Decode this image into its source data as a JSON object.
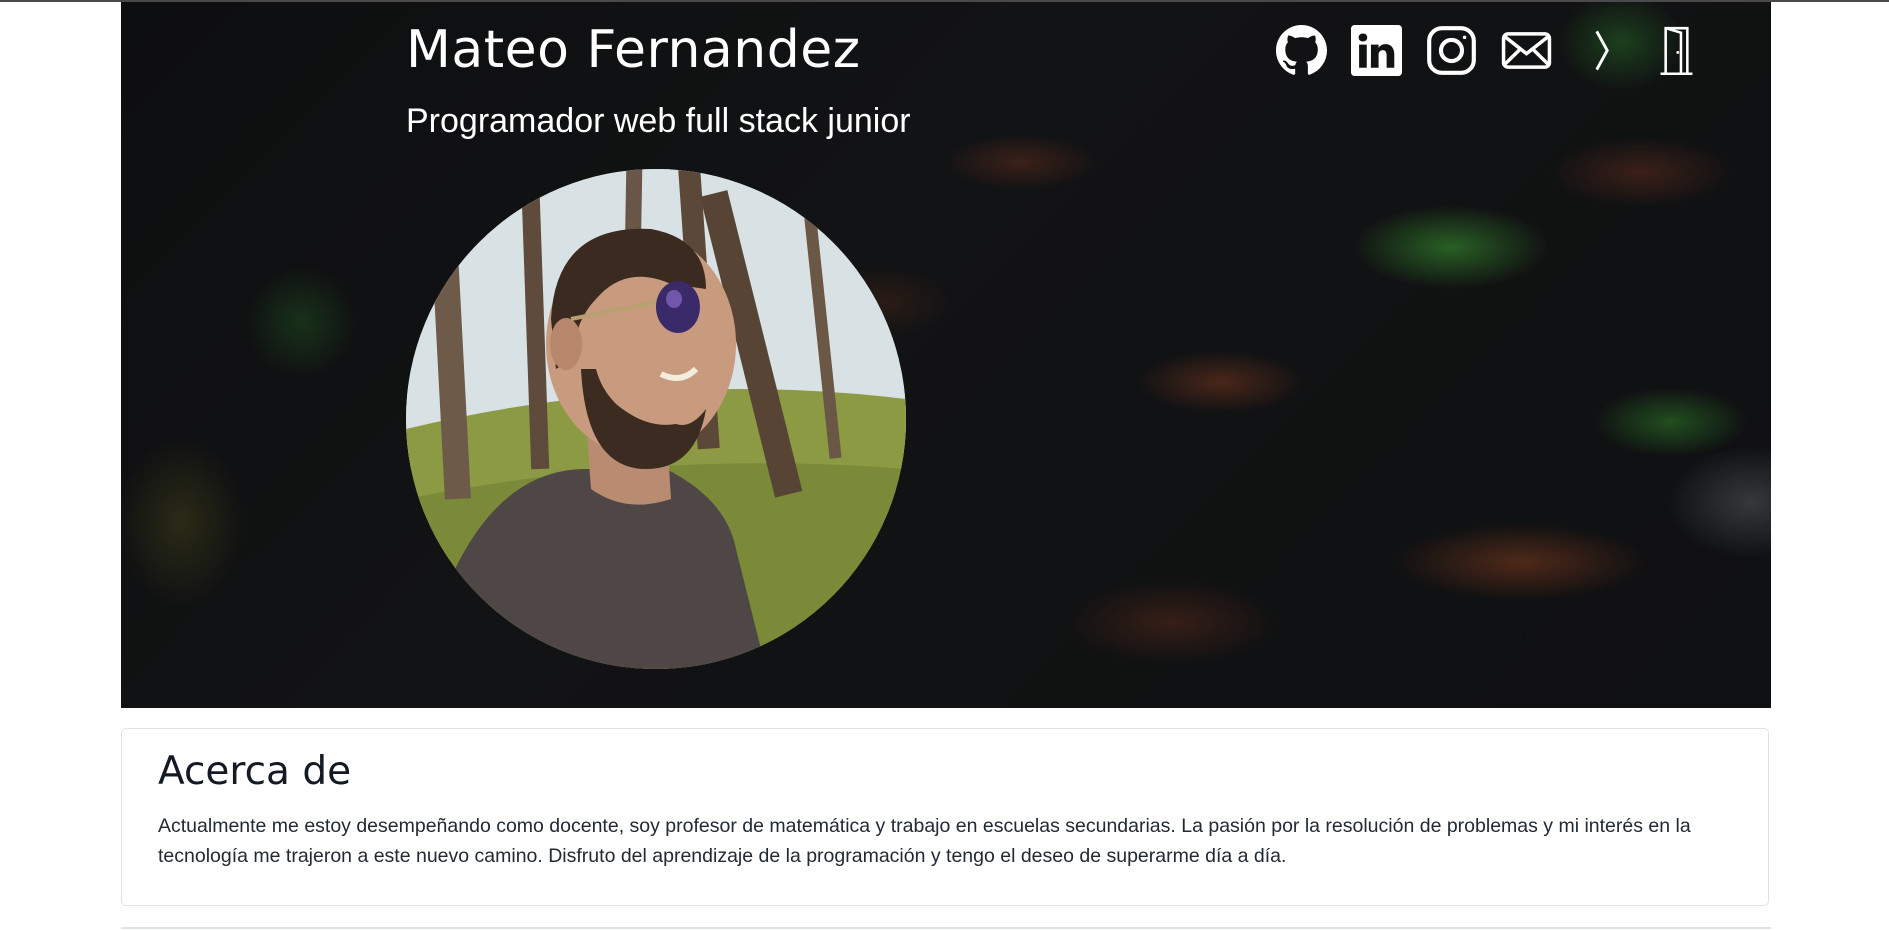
{
  "header": {
    "name": "Mateo Fernandez",
    "subtitle": "Programador web full stack junior"
  },
  "social": [
    {
      "icon": "github-icon"
    },
    {
      "icon": "linkedin-icon"
    },
    {
      "icon": "instagram-icon"
    },
    {
      "icon": "mail-icon"
    },
    {
      "icon": "chevron-right-icon"
    },
    {
      "icon": "door-icon"
    }
  ],
  "about": {
    "title": "Acerca de",
    "text": "Actualmente me estoy desempeñando como docente, soy profesor de matemática y trabajo en escuelas secundarias. La pasión por la resolución de problemas y mi interés en la tecnología me trajeron a este nuevo camino. Disfruto del aprendizaje de la programación y tengo el deseo de superarme día a día."
  },
  "colors": {
    "banner_bg": "#0f1011",
    "text_light": "#ffffff",
    "text_dark": "#141a24",
    "border": "#dee2e6"
  }
}
